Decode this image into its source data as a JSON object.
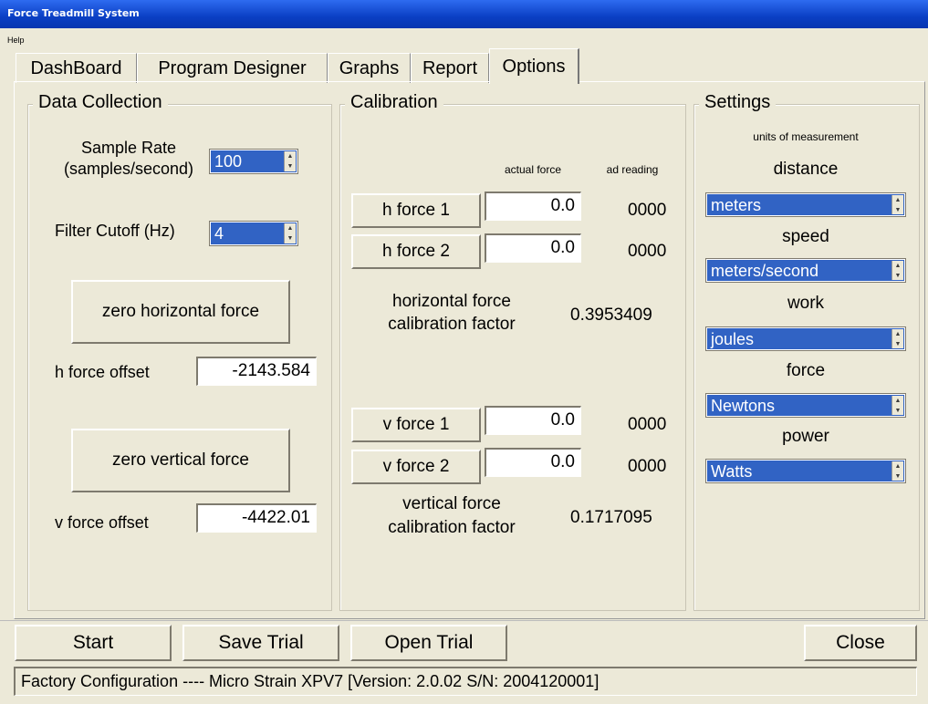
{
  "window": {
    "title": "Force Treadmill System"
  },
  "menu": {
    "help": "Help"
  },
  "tabs": [
    {
      "label": "DashBoard"
    },
    {
      "label": "Program Designer"
    },
    {
      "label": "Graphs"
    },
    {
      "label": "Report"
    },
    {
      "label": "Options"
    }
  ],
  "data_collection": {
    "legend": "Data Collection",
    "sample_rate_label_1": "Sample Rate",
    "sample_rate_label_2": "(samples/second)",
    "sample_rate_value": "100",
    "filter_cutoff_label": "Filter Cutoff (Hz)",
    "filter_cutoff_value": "4",
    "zero_horizontal_button": "zero horizontal force",
    "h_offset_label": "h force offset",
    "h_offset_value": "-2143.584",
    "zero_vertical_button": "zero vertical force",
    "v_offset_label": "v force offset",
    "v_offset_value": "-4422.01"
  },
  "calibration": {
    "legend": "Calibration",
    "col_actual": "actual force",
    "col_ad": "ad reading",
    "h_force_1": {
      "label": "h force 1",
      "actual": "0.0",
      "ad": "0000"
    },
    "h_force_2": {
      "label": "h force 2",
      "actual": "0.0",
      "ad": "0000"
    },
    "h_factor_label_1": "horizontal force",
    "h_factor_label_2": "calibration factor",
    "h_factor_value": "0.3953409",
    "v_force_1": {
      "label": "v force 1",
      "actual": "0.0",
      "ad": "0000"
    },
    "v_force_2": {
      "label": "v force 2",
      "actual": "0.0",
      "ad": "0000"
    },
    "v_factor_label_1": "vertical force",
    "v_factor_label_2": "calibration factor",
    "v_factor_value": "0.1717095"
  },
  "settings": {
    "legend": "Settings",
    "units_label": "units of measurement",
    "distance_label": "distance",
    "distance_value": "meters",
    "speed_label": "speed",
    "speed_value": "meters/second",
    "work_label": "work",
    "work_value": "joules",
    "force_label": "force",
    "force_value": "Newtons",
    "power_label": "power",
    "power_value": "Watts"
  },
  "actions": {
    "start": "Start",
    "save_trial": "Save Trial",
    "open_trial": "Open Trial",
    "close": "Close"
  },
  "status": {
    "text": "Factory Configuration  ----  Micro Strain XPV7 [Version: 2.0.02 S/N: 2004120001]"
  },
  "colors": {
    "selection": "#3163C4",
    "face": "#ECE9D8",
    "titlebar": "#0A3FC4"
  }
}
